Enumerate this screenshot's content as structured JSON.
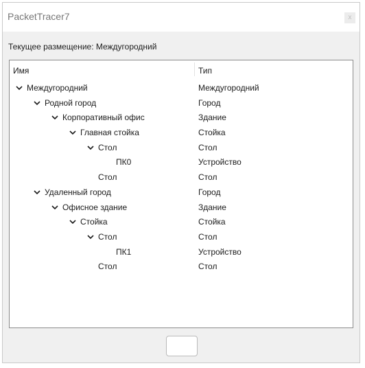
{
  "window": {
    "title": "PacketTracer7",
    "close_label": "x"
  },
  "location": {
    "text": "Текущее размещение: Междугородний"
  },
  "tree": {
    "columns": {
      "name": "Имя",
      "type": "Тип"
    },
    "rows": [
      {
        "name": "Междугородний",
        "type": "Междугородний",
        "level": 0,
        "expanded": true
      },
      {
        "name": "Родной город",
        "type": "Город",
        "level": 1,
        "expanded": true
      },
      {
        "name": "Корпоративный офис",
        "type": "Здание",
        "level": 2,
        "expanded": true
      },
      {
        "name": "Главная стойка",
        "type": "Стойка",
        "level": 3,
        "expanded": true
      },
      {
        "name": "Стол",
        "type": "Стол",
        "level": 4,
        "expanded": true
      },
      {
        "name": "ПК0",
        "type": "Устройство",
        "level": 5,
        "expanded": false
      },
      {
        "name": "Стол",
        "type": "Стол",
        "level": 4,
        "expanded": false
      },
      {
        "name": "Удаленный город",
        "type": "Город",
        "level": 1,
        "expanded": true
      },
      {
        "name": "Офисное здание",
        "type": "Здание",
        "level": 2,
        "expanded": true
      },
      {
        "name": "Стойка",
        "type": "Стойка",
        "level": 3,
        "expanded": true
      },
      {
        "name": "Стол",
        "type": "Стол",
        "level": 4,
        "expanded": true
      },
      {
        "name": "ПК1",
        "type": "Устройство",
        "level": 5,
        "expanded": false
      },
      {
        "name": "Стол",
        "type": "Стол",
        "level": 4,
        "expanded": false
      }
    ]
  },
  "footer": {
    "button_label": ""
  }
}
